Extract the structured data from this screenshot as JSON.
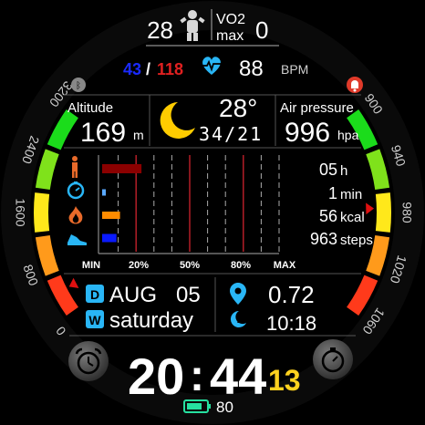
{
  "header": {
    "steps_left": "28",
    "vo2_label_top": "VO2",
    "vo2_label_bottom": "max",
    "vo2_value": "0"
  },
  "heart": {
    "min": "43",
    "slash": "/",
    "max": "118",
    "bpm": "88",
    "unit": "BPM"
  },
  "altitude": {
    "label": "Altitude",
    "value": "169",
    "unit": "m"
  },
  "weather": {
    "temp": "28°",
    "range": "34/21"
  },
  "pressure": {
    "label": "Air pressure",
    "value": "996",
    "unit": "hpa"
  },
  "left_scale": {
    "ticks": [
      "3200",
      "2400",
      "1600",
      "800",
      "0"
    ],
    "level": 0.12
  },
  "right_scale": {
    "ticks": [
      "900",
      "940",
      "980",
      "1020",
      "1060"
    ],
    "level": 0.48
  },
  "activity": {
    "rows": [
      {
        "value": "05",
        "unit": "h",
        "fraction": 0.22,
        "color": "#8b0000"
      },
      {
        "value": "1",
        "unit": "min",
        "fraction": 0.02,
        "color": "#5aa9ff"
      },
      {
        "value": "56",
        "unit": "kcal",
        "fraction": 0.1,
        "color": "#ff8c00"
      },
      {
        "value": "963",
        "unit": "steps",
        "fraction": 0.08,
        "color": "#0a1aff"
      }
    ],
    "axis": [
      "MIN",
      "20%",
      "50%",
      "80%",
      "MAX"
    ]
  },
  "date": {
    "month": "AUG",
    "day": "05",
    "weekday": "saturday",
    "d_badge": "D",
    "w_badge": "W"
  },
  "distance": {
    "value": "0.72"
  },
  "moon": {
    "time": "10:18"
  },
  "clock": {
    "hours": "20",
    "colon": ":",
    "minutes": "44",
    "seconds": "13"
  },
  "battery": {
    "value": "80",
    "level": 0.8
  },
  "colors": {
    "accent_red": "#e02020",
    "accent_blue": "#1a2aff",
    "icon_blue": "#29b6f6",
    "seconds_yellow": "#ffd21f",
    "battery_green": "#26e0a0"
  }
}
